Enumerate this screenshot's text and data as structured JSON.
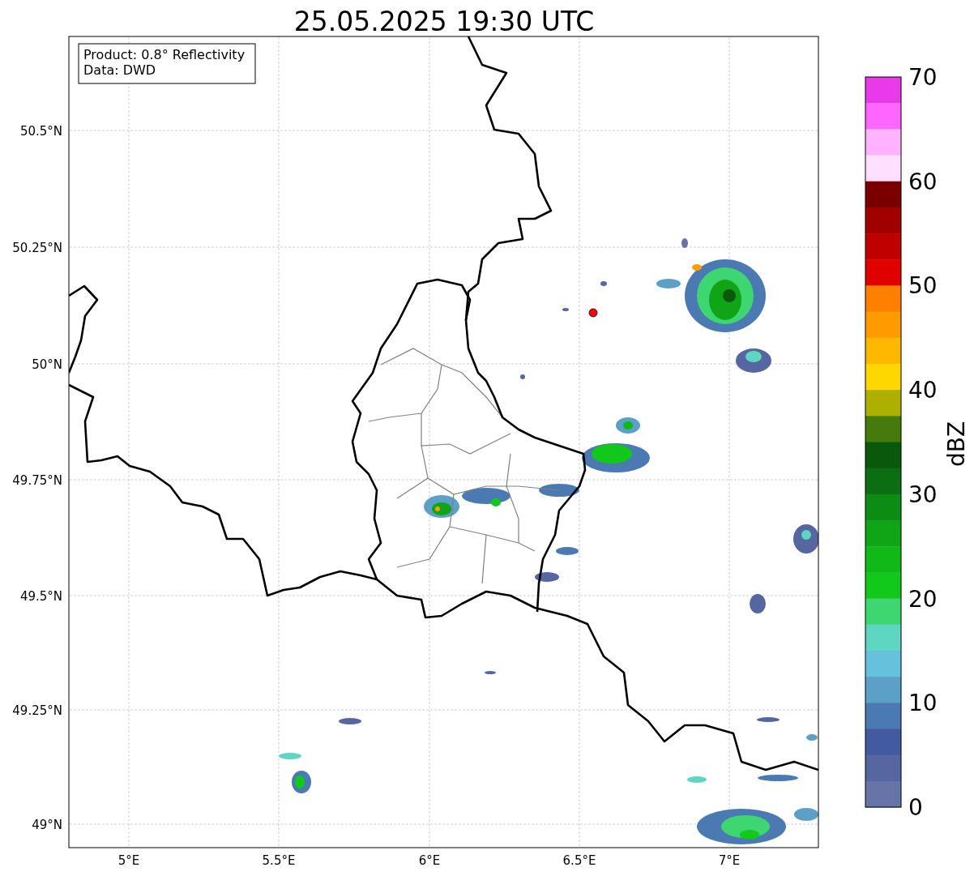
{
  "title": "25.05.2025 19:30 UTC",
  "info_box": [
    "Product: 0.8° Reflectivity",
    "Data: DWD"
  ],
  "lat_ticks": [
    "50.5°N",
    "50.25°N",
    "50°N",
    "49.75°N",
    "49.5°N",
    "49.25°N",
    "49°N"
  ],
  "lon_ticks": [
    "5°E",
    "5.5°E",
    "6°E",
    "6.5°E",
    "7°E"
  ],
  "colorbar": {
    "label": "dBZ",
    "ticks": [
      "70",
      "60",
      "50",
      "40",
      "30",
      "20",
      "10",
      "0"
    ],
    "bins": [
      {
        "color": "#e83ae8"
      },
      {
        "color": "#ff66ff"
      },
      {
        "color": "#ffb3ff"
      },
      {
        "color": "#ffdfff"
      },
      {
        "color": "#7a0000"
      },
      {
        "color": "#a00000"
      },
      {
        "color": "#c00000"
      },
      {
        "color": "#e00000"
      },
      {
        "color": "#ff7f00"
      },
      {
        "color": "#ff9b00"
      },
      {
        "color": "#ffb800"
      },
      {
        "color": "#ffd700"
      },
      {
        "color": "#adb000"
      },
      {
        "color": "#467a0c"
      },
      {
        "color": "#0a580c"
      },
      {
        "color": "#0c6d12"
      },
      {
        "color": "#0d8c14"
      },
      {
        "color": "#0fa516"
      },
      {
        "color": "#10b818"
      },
      {
        "color": "#12c81a"
      },
      {
        "color": "#3ed670"
      },
      {
        "color": "#5fd6c2"
      },
      {
        "color": "#66c2dc"
      },
      {
        "color": "#5ca0c8"
      },
      {
        "color": "#4b7ab2"
      },
      {
        "color": "#425a9f"
      },
      {
        "color": "#5566a0"
      },
      {
        "color": "#6674a8"
      }
    ]
  }
}
